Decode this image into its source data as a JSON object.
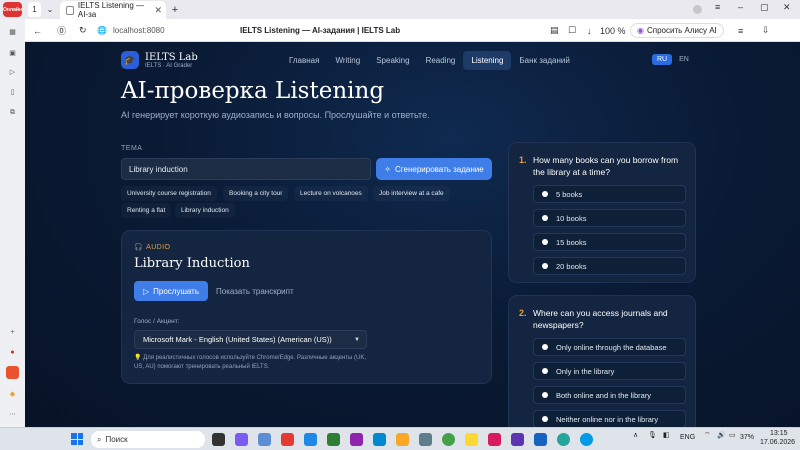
{
  "browser": {
    "tab_counter": "1",
    "tab_title": "IELTS Listening — AI-за",
    "url": "localhost:8080",
    "page_title": "IELTS Listening — AI-задания | IELTS Lab",
    "zoom": "100 %",
    "alice_label": "Спросить Алису AI"
  },
  "site": {
    "brand_name": "IELTS Lab",
    "brand_sub": "IELTS · AI Grader",
    "nav": [
      "Главная",
      "Writing",
      "Speaking",
      "Reading",
      "Listening",
      "Банк заданий"
    ],
    "active_nav": "Listening",
    "lang": [
      "RU",
      "EN"
    ],
    "active_lang": "RU"
  },
  "hero": {
    "title": "AI-проверка Listening",
    "subtitle": "AI генерирует короткую аудиозапись и вопросы. Прослушайте и ответьте."
  },
  "topic": {
    "label": "ТЕМА",
    "value": "Library induction",
    "generate_label": "Сгенерировать задание",
    "chips": [
      "University course registration",
      "Booking a city tour",
      "Lecture on volcanoes",
      "Job interview at a cafe",
      "Renting a flat",
      "Library induction"
    ]
  },
  "audio": {
    "tag": "AUDIO",
    "title": "Library Induction",
    "listen_label": "Прослушать",
    "transcript_label": "Показать транскрипт",
    "voice_label": "Голос / Акцент:",
    "voice_value": "Microsoft Mark - English (United States) (American (US))",
    "hint": "Для реалистичных голосов используйте Chrome/Edge. Различные акценты (UK, US, AU) помогают тренировать реальный IELTS."
  },
  "questions": [
    {
      "num": "1.",
      "text": "How many books can you borrow from the library at a time?",
      "options": [
        "5 books",
        "10 books",
        "15 books",
        "20 books"
      ]
    },
    {
      "num": "2.",
      "text": "Where can you access journals and newspapers?",
      "options": [
        "Only online through the database",
        "Only in the library",
        "Both online and in the library",
        "Neither online nor in the library"
      ]
    }
  ],
  "taskbar": {
    "search_placeholder": "Поиск",
    "lang": "ENG",
    "battery": "37%",
    "time": "13:15",
    "date": "17.06.2026"
  }
}
